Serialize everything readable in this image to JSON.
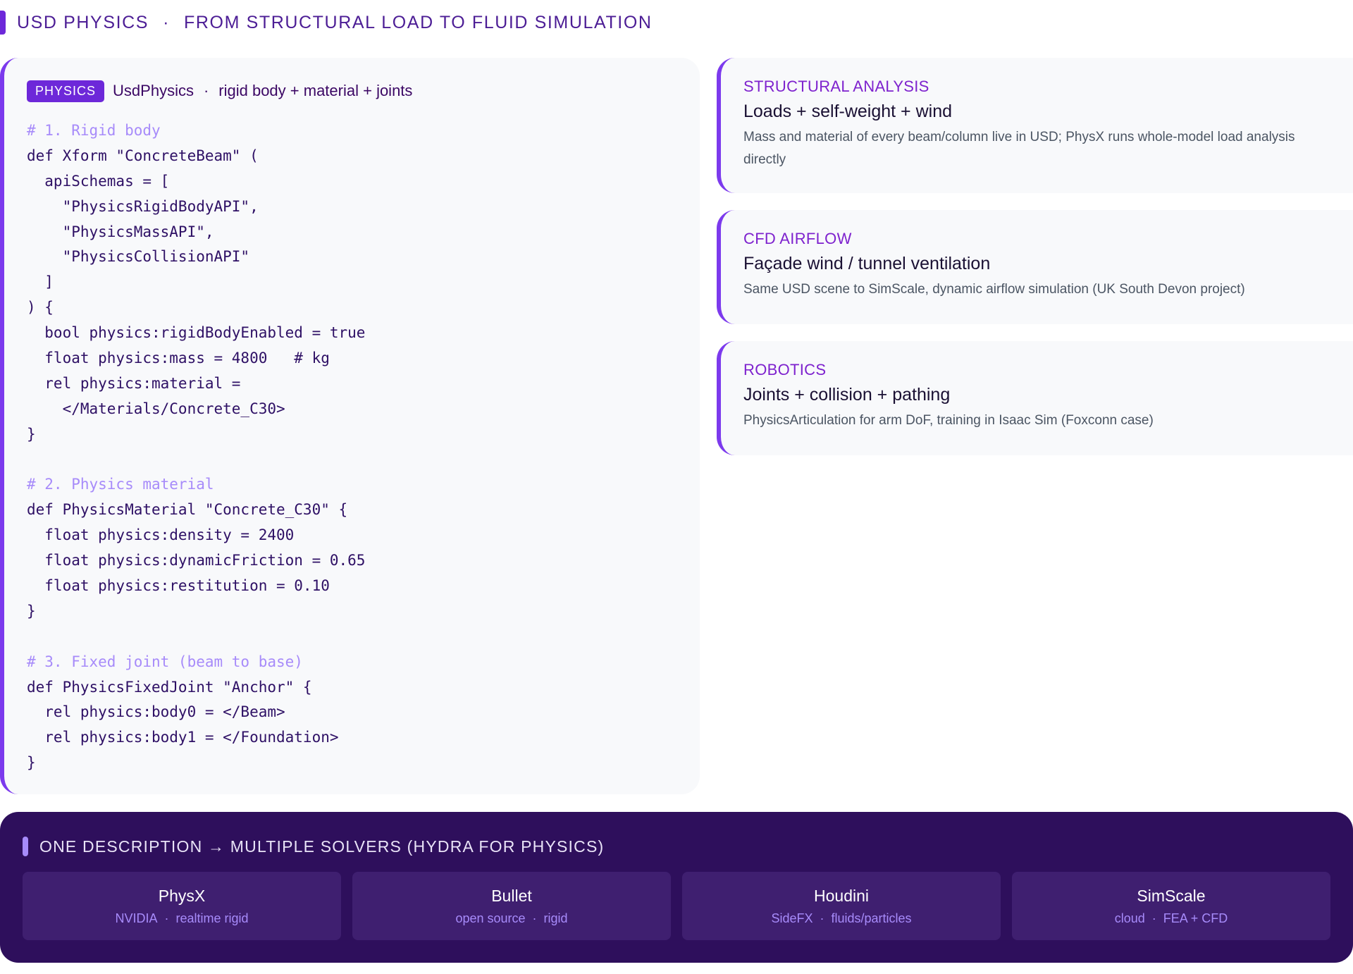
{
  "header": {
    "title_left": "USD PHYSICS",
    "separator": "·",
    "title_right": "FROM STRUCTURAL LOAD TO FLUID SIMULATION"
  },
  "code_panel": {
    "badge": "PHYSICS",
    "title": "UsdPhysics",
    "separator": "·",
    "subtitle": "rigid body + material + joints",
    "lines": [
      {
        "text": "# 1. Rigid body",
        "comment": true
      },
      {
        "text": "def Xform \"ConcreteBeam\" (",
        "comment": false
      },
      {
        "text": "  apiSchemas = [",
        "comment": false
      },
      {
        "text": "    \"PhysicsRigidBodyAPI\",",
        "comment": false
      },
      {
        "text": "    \"PhysicsMassAPI\",",
        "comment": false
      },
      {
        "text": "    \"PhysicsCollisionAPI\"",
        "comment": false
      },
      {
        "text": "  ]",
        "comment": false
      },
      {
        "text": ") {",
        "comment": false
      },
      {
        "text": "  bool physics:rigidBodyEnabled = true",
        "comment": false
      },
      {
        "text": "  float physics:mass = 4800   # kg",
        "comment": false
      },
      {
        "text": "  rel physics:material =",
        "comment": false
      },
      {
        "text": "    </Materials/Concrete_C30>",
        "comment": false
      },
      {
        "text": "}",
        "comment": false
      },
      {
        "text": "",
        "comment": false
      },
      {
        "text": "# 2. Physics material",
        "comment": true
      },
      {
        "text": "def PhysicsMaterial \"Concrete_C30\" {",
        "comment": false
      },
      {
        "text": "  float physics:density = 2400",
        "comment": false
      },
      {
        "text": "  float physics:dynamicFriction = 0.65",
        "comment": false
      },
      {
        "text": "  float physics:restitution = 0.10",
        "comment": false
      },
      {
        "text": "}",
        "comment": false
      },
      {
        "text": "",
        "comment": false
      },
      {
        "text": "# 3. Fixed joint (beam to base)",
        "comment": true
      },
      {
        "text": "def PhysicsFixedJoint \"Anchor\" {",
        "comment": false
      },
      {
        "text": "  rel physics:body0 = </Beam>",
        "comment": false
      },
      {
        "text": "  rel physics:body1 = </Foundation>",
        "comment": false
      },
      {
        "text": "}",
        "comment": false
      }
    ]
  },
  "cards": {
    "structural": {
      "label": "STRUCTURAL ANALYSIS",
      "title": "Loads + self-weight + wind",
      "description": "Mass and material of every beam/column live in USD; PhysX runs whole-model load analysis directly"
    },
    "cfd": {
      "label": "CFD AIRFLOW",
      "title": "Façade wind / tunnel ventilation",
      "description": "Same USD scene to SimScale, dynamic airflow simulation (UK South Devon project)"
    },
    "robotics": {
      "label": "ROBOTICS",
      "title": "Joints + collision + pathing",
      "description": "PhysicsArticulation for arm DoF, training in Isaac Sim (Foxconn case)"
    }
  },
  "solvers": {
    "heading": "ONE DESCRIPTION → MULTIPLE SOLVERS (HYDRA FOR PHYSICS)",
    "separator": "·",
    "items": [
      {
        "name": "PhysX",
        "sub_a": "NVIDIA",
        "sub_b": "realtime rigid"
      },
      {
        "name": "Bullet",
        "sub_a": "open source",
        "sub_b": "rigid"
      },
      {
        "name": "Houdini",
        "sub_a": "SideFX",
        "sub_b": "fluids/particles"
      },
      {
        "name": "SimScale",
        "sub_a": "cloud",
        "sub_b": "FEA + CFD"
      }
    ]
  },
  "colors": {
    "accent": "#6d28d9",
    "accent_light": "#a78bfa",
    "dark_panel": "#2e0f5c",
    "card_bg": "#f8f9fb"
  }
}
